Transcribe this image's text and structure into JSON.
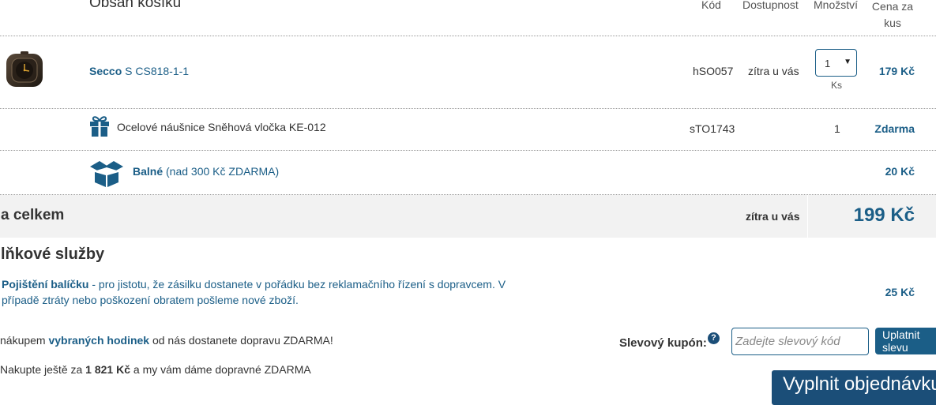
{
  "cart": {
    "title": "Obsah košíku",
    "headers": {
      "code": "Kód",
      "availability": "Dostupnost",
      "quantity": "Množství",
      "unit_price": "Cena za kus"
    },
    "items": [
      {
        "name_bold": "Secco",
        "name_rest": " S CS818-1-1",
        "code": "hSO057",
        "availability": "zítra u vás",
        "quantity": "1",
        "unit": "Ks",
        "price": "179 Kč"
      }
    ],
    "gift": {
      "name": "Ocelové náušnice Sněhová vločka KE-012",
      "code": "sTO1743",
      "quantity": "1",
      "price": "Zdarma"
    },
    "packing": {
      "label_bold": "Balné",
      "label_rest": " (nad 300 Kč ZDARMA)",
      "price": "20 Kč"
    }
  },
  "total": {
    "label": "a celkem",
    "availability": "zítra u vás",
    "price": "199 Kč"
  },
  "services": {
    "title": "lňkové služby",
    "insurance": {
      "title": "Pojištění balíčku",
      "desc_line1": " - pro jistotu, že zásilku dostanete v pořádku bez reklamačního řízení s dopravcem. V",
      "desc_line2": "případě ztráty nebo poškození obratem pošleme nové zboží.",
      "price": "25 Kč"
    }
  },
  "promo": {
    "line1_pre": "nákupem ",
    "line1_bold": "vybraných hodinek",
    "line1_post": " od nás dostanete dopravu ZDARMA!",
    "line2_pre": "Nakupte ještě za ",
    "line2_bold": "1 821 Kč",
    "line2_post": " a my vám dáme dopravné ZDARMA"
  },
  "coupon": {
    "label": "Slevový kupón:",
    "help": "?",
    "placeholder": "Zadejte slevový kód",
    "apply_label": "Uplatnit slevu"
  },
  "order_button": "Vyplnit objednávku",
  "icons": {
    "product": "alarm-clock-icon",
    "gift": "gift-icon",
    "packing": "box-icon"
  },
  "colors": {
    "accent": "#1b5e87",
    "order_button": "#1b4e78",
    "total_bg": "#f2f2f2"
  }
}
